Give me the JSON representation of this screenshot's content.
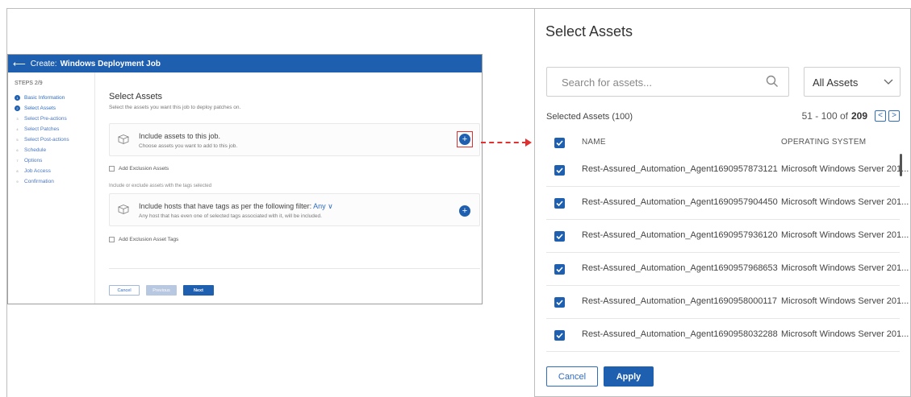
{
  "left_screen": {
    "header": {
      "back_icon": "arrow-left-icon",
      "prefix": "Create:",
      "title": "Windows Deployment Job"
    },
    "steps_title": "STEPS 2/9",
    "steps": [
      {
        "num": "1",
        "label": "Basic Information",
        "state": "done"
      },
      {
        "num": "2",
        "label": "Select Assets",
        "state": "current"
      },
      {
        "num": "3",
        "label": "Select Pre-actions",
        "state": "pending"
      },
      {
        "num": "4",
        "label": "Select Patches",
        "state": "pending"
      },
      {
        "num": "5",
        "label": "Select Post-actions",
        "state": "pending"
      },
      {
        "num": "6",
        "label": "Schedule",
        "state": "pending"
      },
      {
        "num": "7",
        "label": "Options",
        "state": "pending"
      },
      {
        "num": "8",
        "label": "Job Access",
        "state": "pending"
      },
      {
        "num": "9",
        "label": "Confirmation",
        "state": "pending"
      }
    ],
    "main": {
      "title": "Select Assets",
      "subtitle": "Select the assets you want this job to deploy patches on.",
      "include_assets_title": "Include assets to this job.",
      "include_assets_sub": "Choose assets you want to add to this job.",
      "add_exclusion_assets": "Add Exclusion Assets",
      "tags_note": "Include or exclude assets with the tags selected",
      "include_hosts_title": "Include hosts that have tags as per the following filter:",
      "include_hosts_filter": "Any",
      "include_hosts_sub": "Any host that has even one of selected tags associated with it, will be included.",
      "add_exclusion_tags": "Add Exclusion Asset Tags",
      "buttons": {
        "cancel": "Cancel",
        "previous": "Previous",
        "next": "Next"
      }
    }
  },
  "right_panel": {
    "title": "Select Assets",
    "search": {
      "placeholder": "Search for assets..."
    },
    "filter_select": {
      "value": "All Assets"
    },
    "selected_count": "Selected Assets (100)",
    "pager": {
      "range": "51 - 100 of",
      "total": "209",
      "prev": "<",
      "next": ">"
    },
    "columns": {
      "name": "NAME",
      "os": "OPERATING SYSTEM"
    },
    "rows": [
      {
        "name": "Rest-Assured_Automation_Agent1690957873121",
        "os": "Microsoft Windows Server 201..."
      },
      {
        "name": "Rest-Assured_Automation_Agent1690957904450",
        "os": "Microsoft Windows Server 201..."
      },
      {
        "name": "Rest-Assured_Automation_Agent1690957936120",
        "os": "Microsoft Windows Server 201..."
      },
      {
        "name": "Rest-Assured_Automation_Agent1690957968653",
        "os": "Microsoft Windows Server 201..."
      },
      {
        "name": "Rest-Assured_Automation_Agent1690958000117",
        "os": "Microsoft Windows Server 201..."
      },
      {
        "name": "Rest-Assured_Automation_Agent1690958032288",
        "os": "Microsoft Windows Server 201..."
      }
    ],
    "buttons": {
      "cancel": "Cancel",
      "apply": "Apply"
    }
  },
  "colors": {
    "primary": "#1f5fb0",
    "highlight": "#e03030"
  }
}
